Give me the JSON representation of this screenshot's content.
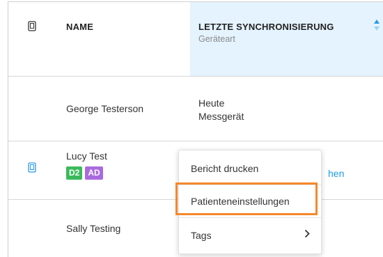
{
  "table": {
    "header": {
      "name_label": "NAME",
      "sync_label": "LETZTE SYNCHRONISIERUNG",
      "sync_sublabel": "Geräteart",
      "icon": "device-icon",
      "sort_icon": "sort-icon"
    },
    "rows": [
      {
        "name": "George Testerson",
        "sync_date": "Heute",
        "sync_device": "Messgerät"
      },
      {
        "name": "Lucy Test",
        "tags": [
          "D2",
          "AD"
        ],
        "icon": "device-icon",
        "link_fragment": "hen"
      },
      {
        "name": "Sally Testing"
      }
    ]
  },
  "context_menu": {
    "items": [
      {
        "label": "Bericht drucken"
      },
      {
        "label": "Patienteneinstellungen",
        "highlighted": true
      },
      {
        "label": "Tags",
        "has_submenu": true
      }
    ]
  },
  "colors": {
    "sorted_column_bg": "#e4f3fd",
    "accent": "#1e9be0",
    "highlight": "#f5882b",
    "tag_d2": "#3cba5b",
    "tag_ad": "#a96ae0"
  }
}
